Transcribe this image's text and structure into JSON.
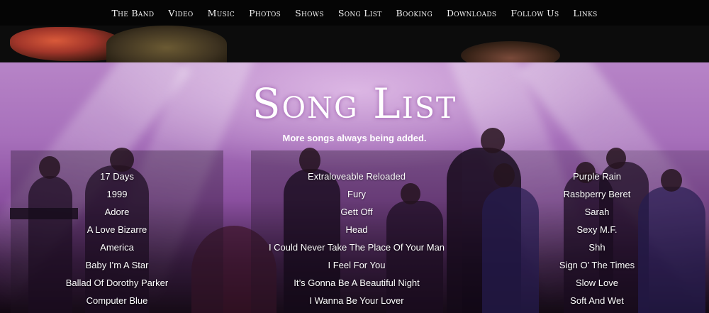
{
  "nav": {
    "items": [
      {
        "label": "The Band"
      },
      {
        "label": "Video"
      },
      {
        "label": "Music"
      },
      {
        "label": "Photos"
      },
      {
        "label": "Shows"
      },
      {
        "label": "Song List"
      },
      {
        "label": "Booking"
      },
      {
        "label": "Downloads"
      },
      {
        "label": "Follow Us"
      },
      {
        "label": "Links"
      }
    ]
  },
  "page": {
    "title": "Song List",
    "subtitle": "More songs always being added."
  },
  "songs": {
    "column1": [
      "17 Days",
      "1999",
      "Adore",
      "A Love Bizarre",
      "America",
      "Baby I’m A Star",
      "Ballad Of Dorothy Parker",
      "Computer Blue"
    ],
    "column2": [
      "Extraloveable Reloaded",
      "Fury",
      "Gett Off",
      "Head",
      "I Could Never Take The Place Of Your Man",
      "I Feel For You",
      "It’s Gonna Be A Beautiful Night",
      "I Wanna Be Your Lover"
    ],
    "column3": [
      "Purple Rain",
      "Rasbperry Beret",
      "Sarah",
      "Sexy M.F.",
      "Shh",
      "Sign O’ The Times",
      "Slow Love",
      "Soft And Wet"
    ]
  },
  "colors": {
    "nav_bg": "#050505",
    "stage_purple": "#a770bb",
    "text": "#ffffff"
  }
}
